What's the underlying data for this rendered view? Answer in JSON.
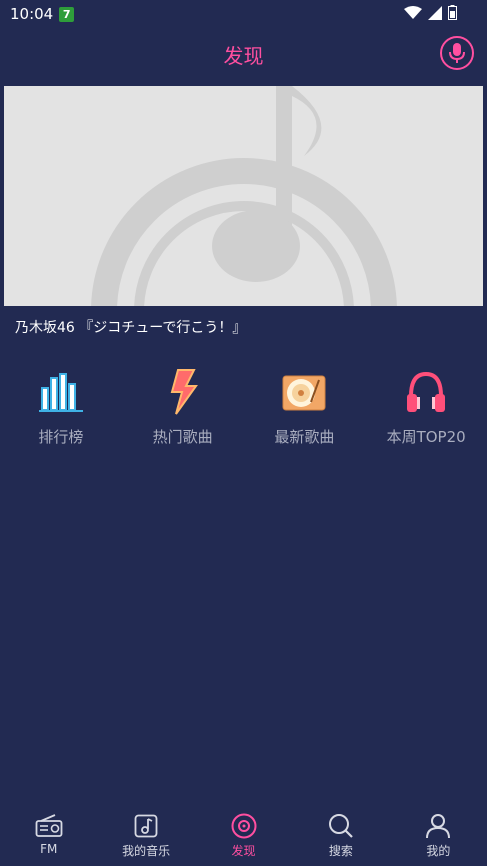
{
  "status": {
    "time": "10:04",
    "badge": "7"
  },
  "header": {
    "title": "发现"
  },
  "banner": {
    "caption": "乃木坂46 『ジコチューで行こう！』"
  },
  "categories": [
    {
      "label": "排行榜",
      "icon": "chart-bars-icon"
    },
    {
      "label": "热门歌曲",
      "icon": "lightning-icon"
    },
    {
      "label": "最新歌曲",
      "icon": "record-player-icon"
    },
    {
      "label": "本周TOP20",
      "icon": "headphones-icon"
    }
  ],
  "nav": [
    {
      "label": "FM",
      "icon": "radio-icon"
    },
    {
      "label": "我的音乐",
      "icon": "music-note-icon"
    },
    {
      "label": "发现",
      "icon": "disc-icon",
      "active": true
    },
    {
      "label": "搜索",
      "icon": "search-icon"
    },
    {
      "label": "我的",
      "icon": "user-icon"
    }
  ],
  "colors": {
    "background": "#222a52",
    "accent": "#ff4fa0",
    "muted_text": "#a9adbf"
  }
}
